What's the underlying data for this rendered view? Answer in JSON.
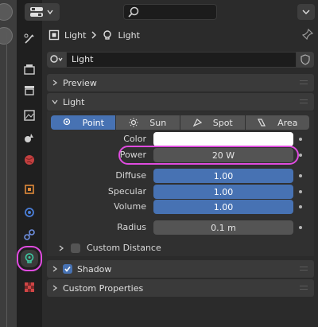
{
  "breadcrumb": {
    "object_name": "Light",
    "data_name": "Light"
  },
  "datablock": {
    "name": "Light"
  },
  "panels": {
    "preview": "Preview",
    "light": "Light",
    "shadow": "Shadow",
    "custom_properties": "Custom Properties"
  },
  "light_types": [
    {
      "label": "Point",
      "icon": "point-light-icon",
      "active": true
    },
    {
      "label": "Sun",
      "icon": "sun-icon",
      "active": false
    },
    {
      "label": "Spot",
      "icon": "spot-light-icon",
      "active": false
    },
    {
      "label": "Area",
      "icon": "area-light-icon",
      "active": false
    }
  ],
  "properties": {
    "color_label": "Color",
    "color_value": "#ffffff",
    "power_label": "Power",
    "power_value": "20 W",
    "diffuse_label": "Diffuse",
    "diffuse_value": "1.00",
    "specular_label": "Specular",
    "specular_value": "1.00",
    "volume_label": "Volume",
    "volume_value": "1.00",
    "radius_label": "Radius",
    "radius_value": "0.1 m"
  },
  "custom_distance": {
    "label": "Custom Distance",
    "checked": false
  },
  "shadow": {
    "checked": true
  },
  "colors": {
    "accent": "#4772b3",
    "highlight": "#e04ce0",
    "panel_bg": "#2b2b2b",
    "tab_bg": "#1f1f1f"
  }
}
